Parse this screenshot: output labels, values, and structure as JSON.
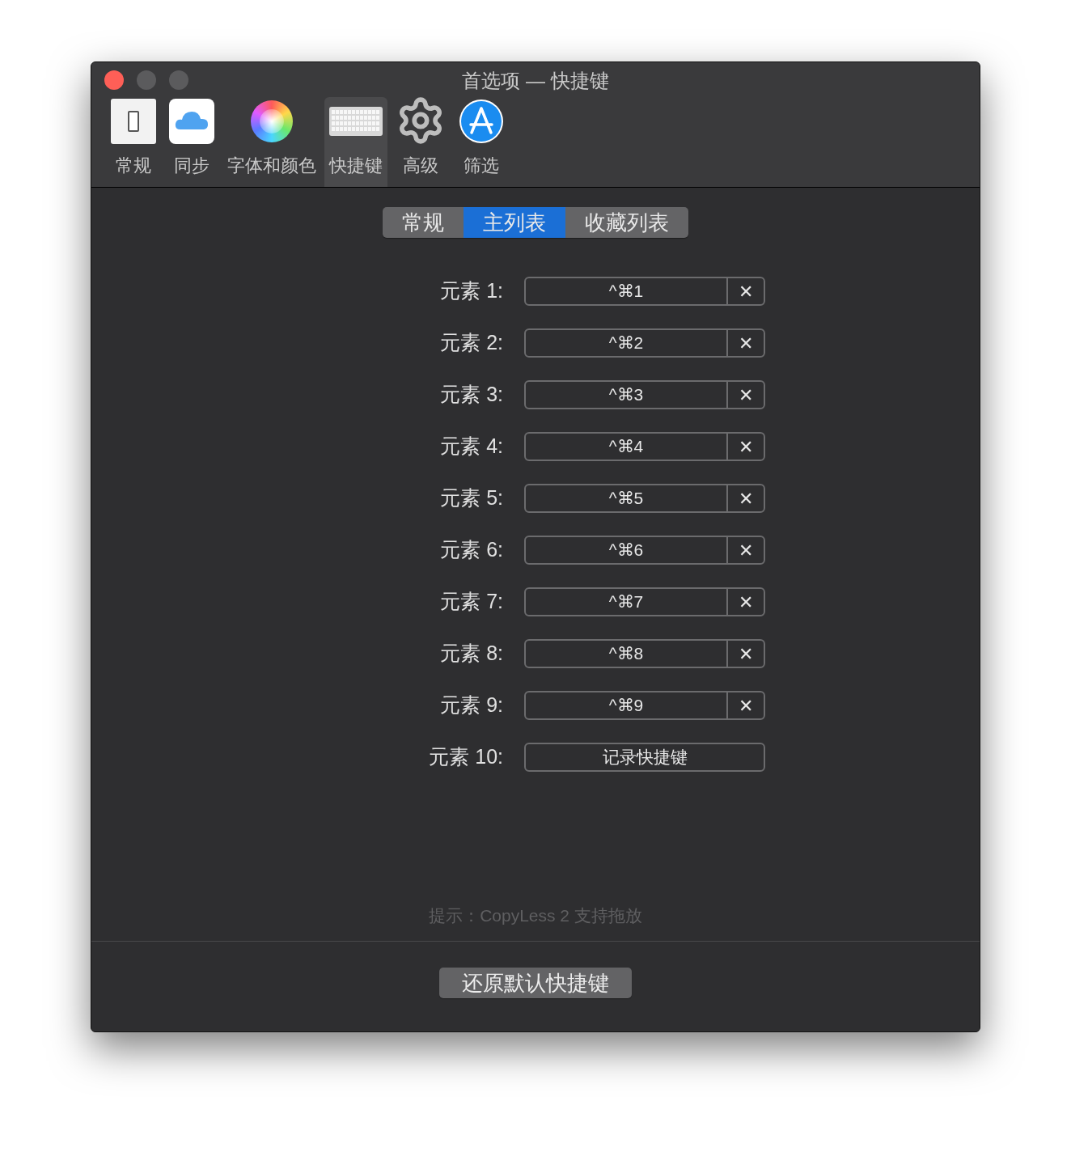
{
  "window": {
    "title": "首选项 — 快捷键"
  },
  "toolbar": [
    {
      "label": "常规",
      "selected": false
    },
    {
      "label": "同步",
      "selected": false
    },
    {
      "label": "字体和颜色",
      "selected": false
    },
    {
      "label": "快捷键",
      "selected": true
    },
    {
      "label": "高级",
      "selected": false
    },
    {
      "label": "筛选",
      "selected": false
    }
  ],
  "segments": [
    {
      "label": "常规",
      "selected": false
    },
    {
      "label": "主列表",
      "selected": true
    },
    {
      "label": "收藏列表",
      "selected": false
    }
  ],
  "shortcuts": [
    {
      "label": "元素 1:",
      "kind": "shortcut",
      "value": "^⌘1",
      "clear": "✕"
    },
    {
      "label": "元素 2:",
      "kind": "shortcut",
      "value": "^⌘2",
      "clear": "✕"
    },
    {
      "label": "元素 3:",
      "kind": "shortcut",
      "value": "^⌘3",
      "clear": "✕"
    },
    {
      "label": "元素 4:",
      "kind": "shortcut",
      "value": "^⌘4",
      "clear": "✕"
    },
    {
      "label": "元素 5:",
      "kind": "shortcut",
      "value": "^⌘5",
      "clear": "✕"
    },
    {
      "label": "元素 6:",
      "kind": "shortcut",
      "value": "^⌘6",
      "clear": "✕"
    },
    {
      "label": "元素 7:",
      "kind": "shortcut",
      "value": "^⌘7",
      "clear": "✕"
    },
    {
      "label": "元素 8:",
      "kind": "shortcut",
      "value": "^⌘8",
      "clear": "✕"
    },
    {
      "label": "元素 9:",
      "kind": "shortcut",
      "value": "^⌘9",
      "clear": "✕"
    },
    {
      "label": "元素 10:",
      "kind": "record",
      "value": "记录快捷键"
    }
  ],
  "hint": "提示：CopyLess 2 支持拖放",
  "reset_button": "还原默认快捷键"
}
